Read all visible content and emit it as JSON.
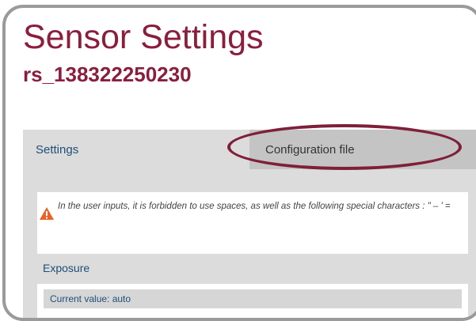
{
  "page": {
    "title": "Sensor Settings",
    "subtitle": "rs_138322250230"
  },
  "tabs": {
    "settings_label": "Settings",
    "config_label": "Configuration file"
  },
  "warning": {
    "icon": "warning-triangle-icon",
    "text": "In the user inputs, it is forbidden to use spaces, as well as the following special characters : \" – ' ="
  },
  "exposure": {
    "title": "Exposure",
    "current_value": "Current value: auto"
  },
  "colors": {
    "accent": "#8b1e3f",
    "tab_inactive": "#c4c4c4",
    "panel_bg": "#dcdcdc",
    "link_blue": "#1f4e79",
    "warning_orange": "#e8632b",
    "highlight_ring": "#7f1f3a"
  }
}
